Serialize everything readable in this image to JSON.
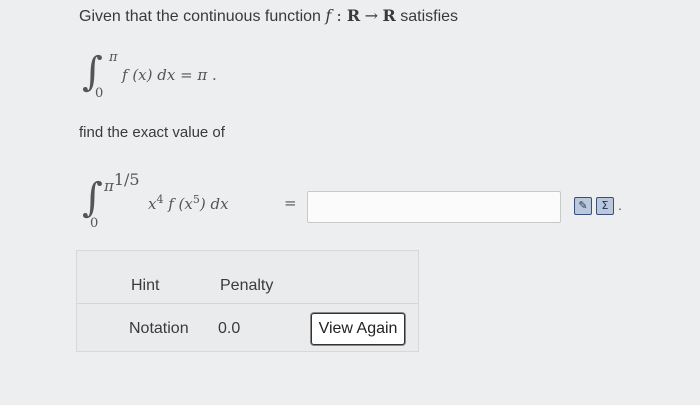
{
  "intro": {
    "text": "Given that the continuous function",
    "fn": "f",
    "colon": " : ",
    "domain": "R",
    "arrow": "→",
    "codomain": "R",
    "suffix": "satisfies"
  },
  "given_integral": {
    "upper": "π",
    "lower": "0",
    "body": "f (x) dx = π ."
  },
  "find_text": "find the exact value of",
  "target_integral": {
    "upper_base": "π",
    "upper_exp": "1/5",
    "lower": "0",
    "body_x": "x",
    "body_x_exp": "4",
    "body_f": " f (x",
    "body_x5_exp": "5",
    "body_rest": ") dx",
    "equals": "="
  },
  "answer": {
    "value": ""
  },
  "tools": {
    "preview_glyph": "✎",
    "sum_glyph": "Σ",
    "trailing": "."
  },
  "hint_table": {
    "hint_label": "Hint",
    "penalty_label": "Penalty",
    "notation_label": "Notation",
    "notation_penalty": "0.0",
    "view_again_label": "View Again"
  },
  "icons": [
    "preview-icon",
    "sum-editor-icon"
  ],
  "colors": {
    "background": "#eceef0",
    "icon_border": "#3c4f7c",
    "icon_fill": "#b9c8dc"
  }
}
